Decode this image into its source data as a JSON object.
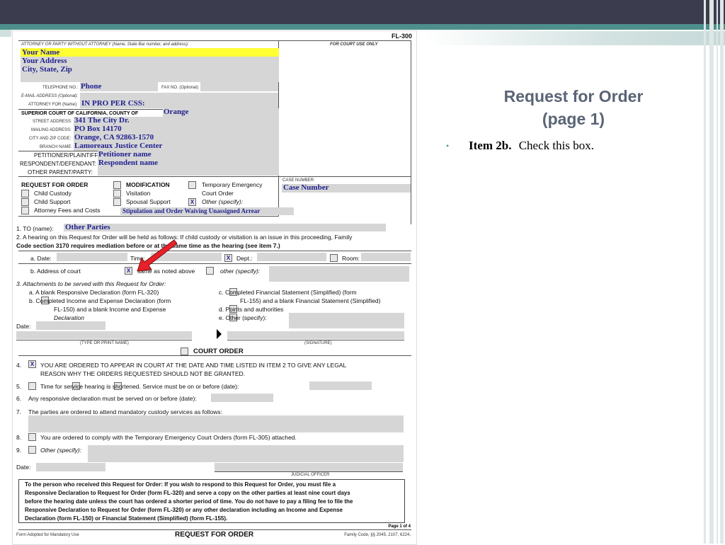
{
  "slide": {
    "title_line1": "Request for Order",
    "title_line2": "(page 1)",
    "bullet_bold": "Item 2b.",
    "bullet_text": "Check this box."
  },
  "form": {
    "form_number": "FL-300",
    "attorney_header": "ATTORNEY OR PARTY WITHOUT ATTORNEY (Name, State Bar number, and address):",
    "court_use": "FOR COURT USE ONLY",
    "name": "Your Name",
    "address": "Your Address",
    "city": "City, State, Zip",
    "telephone_label": "TELEPHONE NO.:",
    "phone": "Phone",
    "fax_label": "FAX NO. (Optional):",
    "email_label": "E-MAIL ADDRESS (Optional):",
    "attorney_for_label": "ATTORNEY FOR (Name):",
    "attorney_for": "IN PRO PER     CSS:",
    "court_label": "SUPERIOR COURT OF CALIFORNIA, COUNTY OF",
    "county": "Orange",
    "street_label": "STREET ADDRESS:",
    "street": "341 The City Dr.",
    "mailing_label": "MAILING ADDRESS:",
    "mailing": "PO Box 14170",
    "cityzip_label": "CITY AND ZIP CODE:",
    "cityzip": "Orange, CA  92863-1570",
    "branch_label": "BRANCH NAME:",
    "branch": "Lamoreaux Justice Center",
    "petitioner_label": "PETITIONER/PLAINTIFF:",
    "petitioner": "Petitioner name",
    "respondent_label": "RESPONDENT/DEFENDANT:",
    "respondent": "Respondent name",
    "other_parent_label": "OTHER PARENT/PARTY:",
    "rfo_label": "REQUEST FOR ORDER",
    "child_custody": "Child Custody",
    "child_support": "Child Support",
    "attorney_fees": "Attorney Fees and Costs",
    "modification": "MODIFICATION",
    "visitation": "Visitation",
    "spousal_support": "Spousal Support",
    "temp_emergency_1": "Temporary Emergency",
    "temp_emergency_2": "Court Order",
    "other_specify": "Other (specify):",
    "stipulation": "Stipulation and Order Waiving Unassigned Arrear",
    "case_number_label": "CASE NUMBER:",
    "case_number": "Case Number",
    "item1": "1.   TO (name):",
    "item1_value": "Other Parties",
    "item2_a": "2.   A hearing on this Request for Order will be held as follows: If child custody or visitation is an issue in this proceeding, Family",
    "item2_b": "Code section 3170 requires mediation before or at the same time as the hearing (see item 7.)",
    "date_label": "a.  Date:",
    "time_label": "Time:",
    "dept_label": "Dept.:",
    "room_label": "Room:",
    "address_court": "b.  Address of court",
    "same_as": "same as noted above",
    "other_specify_lc": "other (specify):",
    "item3": "3.   Attachments to be served with this Request for Order:",
    "item3a": "a.  A blank Responsive Declaration (form FL-320)",
    "item3b1": "b.       Completed Income and Expense Declaration (form",
    "item3b2": "FL-150) and a blank Income and Expense",
    "item3b3": "Declaration",
    "item3c1": "c.       Completed Financial Statement (Simplified) (form",
    "item3c2": "FL-155) and a blank Financial Statement (Simplified)",
    "item3d": "d.       Points and authorities",
    "item3e": "e.       Other (specify):",
    "date": "Date:",
    "type_name": "(TYPE OR PRINT NAME)",
    "signature": "(SIGNATURE)",
    "court_order": "COURT ORDER",
    "item4_1": "YOU ARE ORDERED TO APPEAR IN COURT AT THE DATE AND TIME LISTED IN ITEM 2 TO GIVE ANY LEGAL",
    "item4_2": "REASON WHY THE ORDERS REQUESTED SHOULD NOT BE GRANTED.",
    "item5": "Time for        service         hearing          is shortened. Service must be on or before (date):",
    "item6": "Any responsive declaration must be served on or before (date):",
    "item7": "The parties are ordered to attend mandatory custody services as follows:",
    "item8": "You are ordered to comply with the Temporary Emergency Court Orders (form FL-305) attached.",
    "item9": "Other (specify):",
    "judicial_officer": "JUDICIAL OFFICER",
    "notice_1": "To the person who received this Request for Order: If you wish to respond to this Request for Order, you must file a",
    "notice_2": "Responsive Declaration to Request for Order (form FL-320) and serve a copy on the other parties at least nine court days",
    "notice_3": "before the hearing date unless the court has ordered a shorter period of time. You do not have to pay a filing fee to file the",
    "notice_4": "Responsive Declaration to Request for Order (form FL-320) or any other declaration including an Income and Expense",
    "notice_5": "Declaration (form FL-150) or Financial Statement (Simplified) (form FL-155).",
    "page": "Page 1 of 4",
    "footer_left": "Form Adopted for Mandatory Use",
    "footer_title": "REQUEST FOR ORDER",
    "footer_right": "Family Code, §§ 2045, 2107, 6224,",
    "x": "X"
  },
  "colors": {
    "topbar": "#3b3d4f",
    "accent": "#4e8f8c",
    "title": "#5a6475",
    "fill_blue": "#1f1f8f",
    "highlight": "#ffff33",
    "arrow": "#e8202a"
  }
}
